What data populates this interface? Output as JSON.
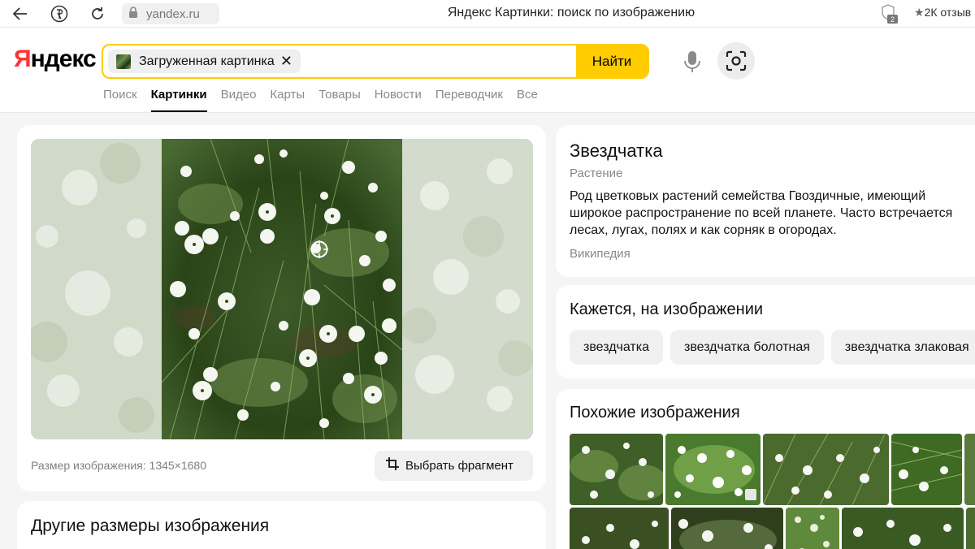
{
  "browser": {
    "url": "yandex.ru",
    "tab_title": "Яндекс Картинки: поиск по изображению",
    "ext_badge": "2",
    "reviews": "2К отзыв"
  },
  "header": {
    "logo_first": "Я",
    "logo_rest": "ндекс",
    "search_chip_label": "Загруженная картинка",
    "search_button": "Найти",
    "nav": [
      "Поиск",
      "Картинки",
      "Видео",
      "Карты",
      "Товары",
      "Новости",
      "Переводчик",
      "Все"
    ],
    "nav_active_index": 1
  },
  "main": {
    "image_size": "Размер изображения: 1345×1680",
    "fragment_button": "Выбрать фрагмент"
  },
  "sizes": {
    "title": "Другие размеры изображения"
  },
  "info": {
    "title": "Звездчатка",
    "subtitle": "Растение",
    "description": "Род цветковых растений семейства Гвоздичные, имеющий\nширокое распространение по всей планете. Часто встречается\nлесах, лугах, полях и как сорняк в огородах.",
    "source": "Википедия"
  },
  "seems": {
    "title": "Кажется, на изображении",
    "tags": [
      "звездчатка",
      "звездчатка болотная",
      "звездчатка злаковая"
    ]
  },
  "similar": {
    "title": "Похожие изображения"
  },
  "colors": {
    "accent": "#ffcc00",
    "logo_red": "#ff3333"
  },
  "icons": [
    "back-arrow-icon",
    "yandex-y-icon",
    "reload-icon",
    "lock-icon",
    "extension-icon",
    "star-icon",
    "clear-icon",
    "microphone-icon",
    "lens-icon",
    "crop-icon",
    "focus-target-icon"
  ]
}
